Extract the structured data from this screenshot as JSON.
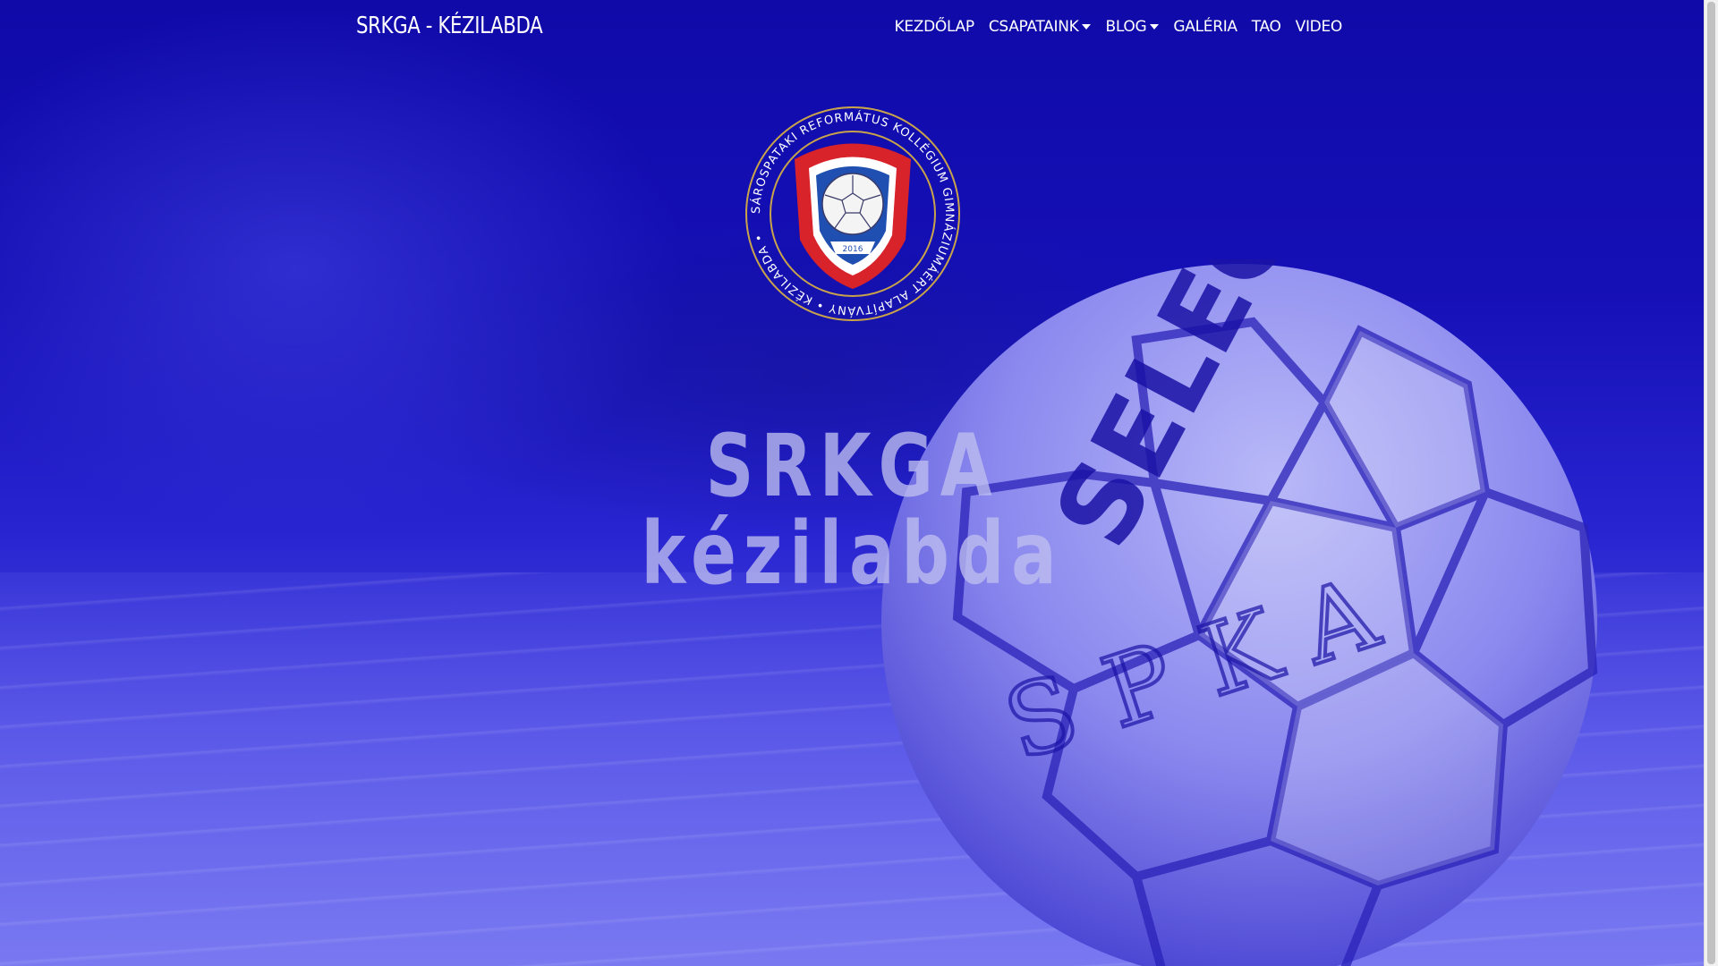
{
  "navbar": {
    "brand": "SRKGA - KÉZILABDA",
    "items": [
      {
        "label": "KEZDŐLAP",
        "dropdown": false
      },
      {
        "label": "CSAPATAINK",
        "dropdown": true
      },
      {
        "label": "BLOG",
        "dropdown": true
      },
      {
        "label": "GALÉRIA",
        "dropdown": false
      },
      {
        "label": "TAO",
        "dropdown": false
      },
      {
        "label": "VIDEO",
        "dropdown": false
      }
    ]
  },
  "emblem": {
    "ring_text": "SÁROSPATAKI REFORMÁTUS KOLLÉGIUM GIMNÁZIUMÁÉRT ALAPÍTVÁNY • KÉZILABDA •",
    "year": "2016"
  },
  "hero": {
    "line1": "SRKGA",
    "line2": "kézilabda"
  },
  "ball": {
    "brand_text": "SELECT",
    "written_text": "SPKA"
  },
  "colors": {
    "overlay": "#1a14c8",
    "text": "#ffffff",
    "emblem_red": "#d8232a",
    "emblem_blue": "#1f4fb0",
    "emblem_gold": "#c9a34a"
  }
}
